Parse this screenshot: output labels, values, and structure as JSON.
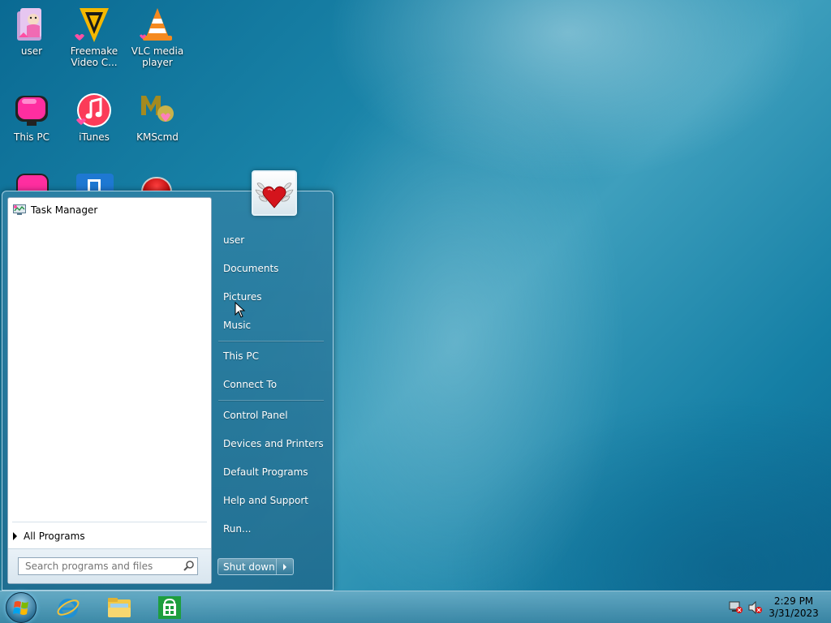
{
  "desktop": {
    "icons": [
      {
        "label": "user"
      },
      {
        "label": "Freemake Video C..."
      },
      {
        "label": "VLC media player"
      },
      {
        "label": "This PC"
      },
      {
        "label": "iTunes"
      },
      {
        "label": "KMScmd"
      }
    ]
  },
  "start_menu": {
    "pinned": [
      {
        "label": "Task Manager",
        "icon": "task-manager-icon"
      }
    ],
    "all_programs_label": "All Programs",
    "search": {
      "placeholder": "Search programs and files",
      "value": ""
    },
    "right_items": [
      {
        "label": "user"
      },
      {
        "label": "Documents"
      },
      {
        "label": "Pictures"
      },
      {
        "label": "Music"
      },
      {
        "label": "This PC"
      },
      {
        "label": "Connect To"
      },
      {
        "label": "Control Panel"
      },
      {
        "label": "Devices and Printers"
      },
      {
        "label": "Default Programs"
      },
      {
        "label": "Help and Support"
      },
      {
        "label": "Run..."
      }
    ],
    "shutdown_label": "Shut down"
  },
  "taskbar": {
    "pinned": [
      {
        "icon": "internet-explorer-icon"
      },
      {
        "icon": "file-explorer-icon"
      },
      {
        "icon": "store-icon"
      }
    ],
    "tray": [
      {
        "icon": "network-disconnected-icon"
      },
      {
        "icon": "volume-muted-icon"
      }
    ],
    "clock": {
      "time": "2:29 PM",
      "date": "3/31/2023"
    }
  },
  "colors": {
    "accent": "#1b86aa",
    "heart": "#d4141c",
    "pink": "#ff4fa3",
    "store_green": "#1e9e3e"
  }
}
